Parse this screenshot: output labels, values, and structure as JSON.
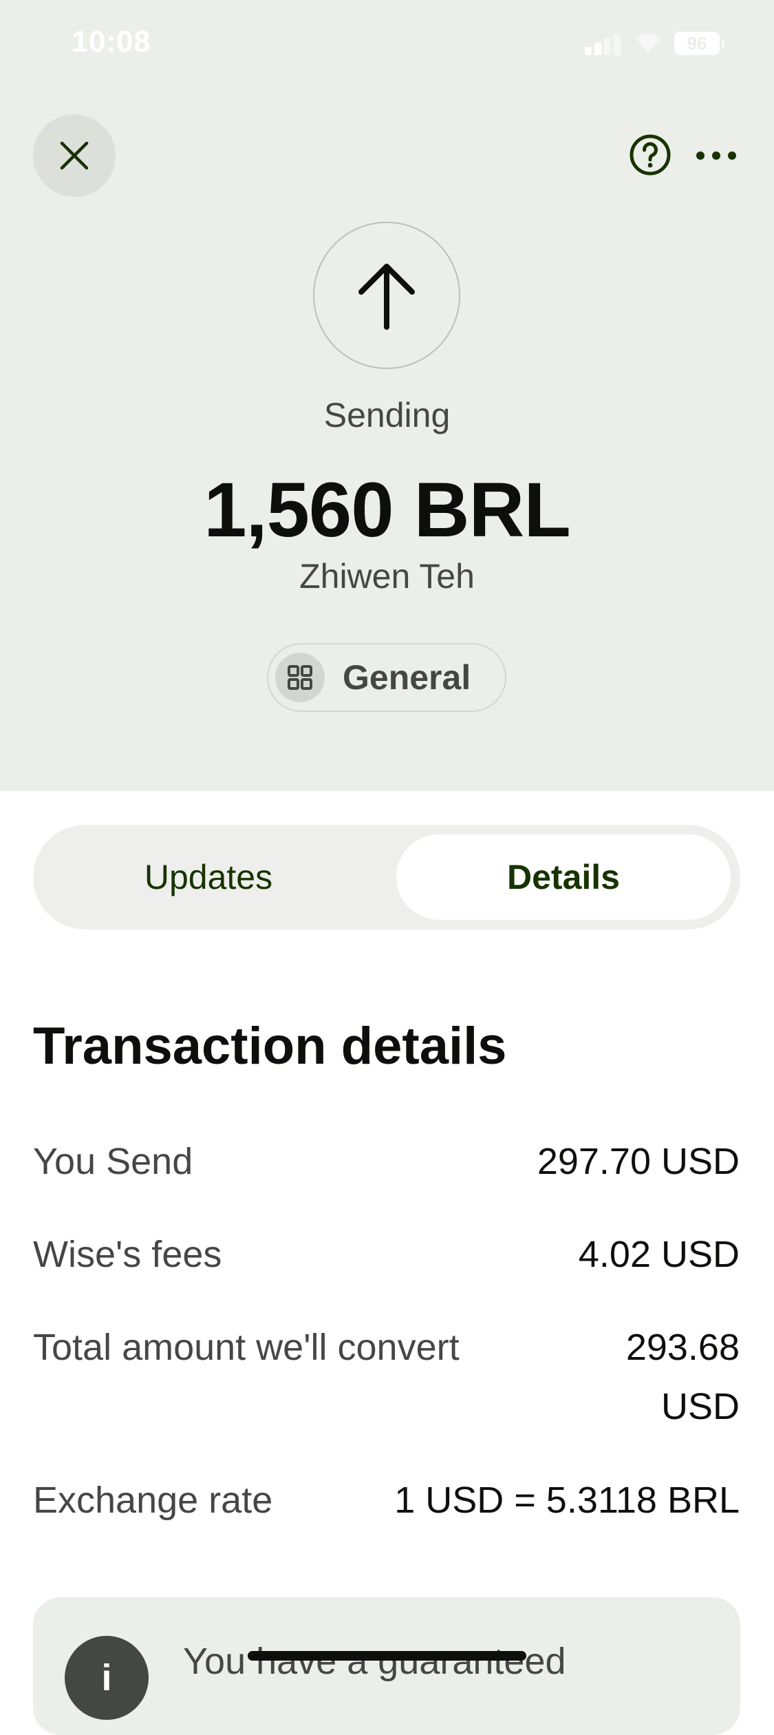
{
  "status_bar": {
    "time": "10:08",
    "battery": "96"
  },
  "header": {
    "close_icon": "close-icon",
    "help_icon": "help-icon",
    "more_icon": "more-icon"
  },
  "transfer": {
    "direction_icon": "arrow-up-icon",
    "status": "Sending",
    "amount": "1,560 BRL",
    "recipient": "Zhiwen Teh",
    "category": "General",
    "category_icon": "grid-icon"
  },
  "tabs": [
    {
      "label": "Updates",
      "selected": false
    },
    {
      "label": "Details",
      "selected": true
    }
  ],
  "details": {
    "title": "Transaction details",
    "rows": [
      {
        "label": "You Send",
        "value": "297.70 USD"
      },
      {
        "label": "Wise's fees",
        "value": "4.02 USD"
      },
      {
        "label": "Total amount we'll convert",
        "value_line1": "293.68",
        "value_line2": "USD"
      },
      {
        "label": "Exchange rate",
        "value": "1 USD = 5.3118 BRL"
      }
    ]
  },
  "info_card": {
    "icon": "info-icon",
    "icon_glyph": "i",
    "text": "You have a guaranteed"
  },
  "colors": {
    "hero_bg": "#eceeea",
    "forest_green": "#163300",
    "text_primary": "#0e0f0c",
    "text_secondary": "#454745"
  }
}
